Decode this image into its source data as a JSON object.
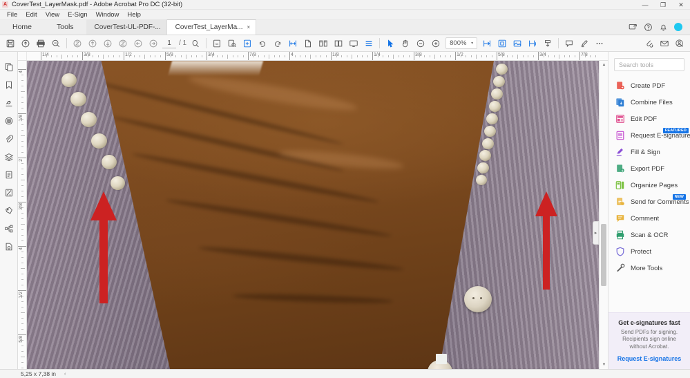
{
  "window": {
    "title": "CoverTest_LayerMask.pdf - Adobe Acrobat Pro DC (32-bit)",
    "app_icon_letter": "A",
    "controls": {
      "minimize": "—",
      "restore": "❐",
      "close": "✕"
    }
  },
  "menubar": {
    "items": [
      "File",
      "Edit",
      "View",
      "E-Sign",
      "Window",
      "Help"
    ]
  },
  "tabbar": {
    "nav_tabs": [
      "Home",
      "Tools"
    ],
    "doc_tabs": [
      {
        "label": "CoverTest-UL-PDF-...",
        "active": false,
        "close": "×"
      },
      {
        "label": "CoverTest_LayerMa...",
        "active": true,
        "close": "×"
      }
    ]
  },
  "titlebar_right_icons": [
    "share-screen-icon",
    "help-icon",
    "notifications-bell-icon",
    "account-avatar"
  ],
  "toolbar": {
    "page_current": "1",
    "page_total": "/ 1",
    "zoom_value": "800%",
    "zoom_caret": "▾",
    "icons_left": [
      "save-icon",
      "upload-cloud-icon",
      "print-icon",
      "zoom-out-tool-icon",
      "fit-page-icon",
      "previous-page-arrow-icon",
      "next-page-arrow-icon",
      "fit-width-icon",
      "go-back-icon",
      "go-forward-icon"
    ],
    "icons_mid": [
      "find-icon",
      "page-thumbnails-icon",
      "snapshot-icon",
      "add-page-icon",
      "rotate-clockwise-icon",
      "rotate-counterclockwise-icon",
      "measure-icon",
      "single-page-icon",
      "two-page-icon",
      "book-view-icon",
      "scroll-view-icon",
      "reading-mode-icon"
    ],
    "icons_right": [
      "select-cursor-icon",
      "hand-tool-icon",
      "zoom-minus-icon",
      "zoom-plus-icon",
      "fit-one-icon",
      "fit-visible-icon",
      "fit-image-icon",
      "fit-select-icon",
      "crop-icon",
      "comment-icon",
      "highlight-pen-icon",
      "more-options-icon"
    ],
    "icons_far_right": [
      "share-file-icon",
      "email-icon",
      "add-person-icon"
    ]
  },
  "left_rail": {
    "items": [
      "page-thumbnails-panel-icon",
      "bookmarks-panel-icon",
      "signature-panel-icon",
      "layers-panel-icon",
      "attachments-panel-icon",
      "content-panel-icon",
      "destinations-panel-icon",
      "tags-panel-icon",
      "stamp-panel-icon",
      "model-tree-panel-icon",
      "security-panel-icon"
    ]
  },
  "rulers": {
    "horizontal_labels": [
      "1/4",
      "3/8",
      "1/2",
      "5/8",
      "3/4",
      "7/8",
      "4",
      "1/8",
      "1/4",
      "3/8",
      "1/2",
      "5/8",
      "3/4",
      "7/8"
    ],
    "vertical_labels": [
      "4",
      "1/8",
      "2",
      "3/8",
      "4",
      "1/2",
      "5/8"
    ]
  },
  "document": {
    "description": "Zoomed-in photograph of a brown garment with grey knit cardigan, pearl trim and buttons",
    "annotations": [
      {
        "type": "red-arrow",
        "name": "annotation-arrow-left"
      },
      {
        "type": "red-arrow",
        "name": "annotation-arrow-right"
      }
    ],
    "annotation_color": "#cc2222"
  },
  "tools_panel": {
    "search_placeholder": "Search tools",
    "search_value": "",
    "tools": [
      {
        "label": "Create PDF",
        "icon": "create-pdf-icon",
        "color": "#e8483c",
        "badge": null
      },
      {
        "label": "Combine Files",
        "icon": "combine-files-icon",
        "color": "#2f7fd4",
        "badge": null
      },
      {
        "label": "Edit PDF",
        "icon": "edit-pdf-icon",
        "color": "#e0508f",
        "badge": null
      },
      {
        "label": "Request E-signatures",
        "icon": "request-esignatures-icon",
        "color": "#c44ad0",
        "badge": "FEATURED"
      },
      {
        "label": "Fill & Sign",
        "icon": "fill-and-sign-icon",
        "color": "#8b4fd6",
        "badge": null
      },
      {
        "label": "Export PDF",
        "icon": "export-pdf-icon",
        "color": "#2f9e6e",
        "badge": null
      },
      {
        "label": "Organize Pages",
        "icon": "organize-pages-icon",
        "color": "#7cc242",
        "badge": null
      },
      {
        "label": "Send for Comments",
        "icon": "send-for-comments-icon",
        "color": "#e8b33c",
        "badge": "NEW"
      },
      {
        "label": "Comment",
        "icon": "comment-tool-icon",
        "color": "#e8b33c",
        "badge": null
      },
      {
        "label": "Scan & OCR",
        "icon": "scan-ocr-icon",
        "color": "#2f9e6e",
        "badge": null
      },
      {
        "label": "Protect",
        "icon": "protect-shield-icon",
        "color": "#7a6fd8",
        "badge": null
      },
      {
        "label": "More Tools",
        "icon": "more-tools-icon",
        "color": "#5b5b5b",
        "badge": null
      }
    ],
    "promo": {
      "title": "Get e-signatures fast",
      "subtitle": "Send PDFs for signing. Recipients sign online without Acrobat.",
      "link": "Request E-signatures"
    }
  },
  "statusbar": {
    "page_size": "5,25 x 7,38 in",
    "caret": "‹"
  },
  "colors": {
    "accent_blue": "#1473e6",
    "annotation_red": "#cc2222",
    "panel_bg": "#fbfbfb",
    "promo_bg": "#f2eef8"
  }
}
